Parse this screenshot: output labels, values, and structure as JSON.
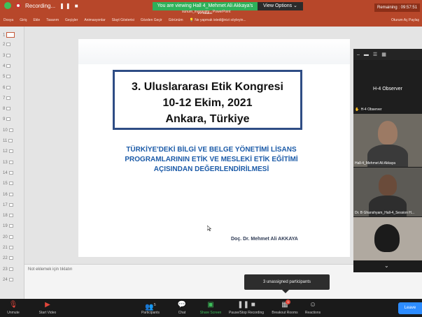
{
  "titlebar": {
    "recording": "Recording...",
    "banner": "You are viewing Hall 4_Mehmet Ali Akkaya's screen",
    "view_options": "View Options ⌄",
    "doc_title": "sunum_masaustu - PowerPoint",
    "remaining": "Remaining : 09:57:51"
  },
  "ribbon": {
    "tabs": [
      "Dosya",
      "Giriş",
      "Ekle",
      "Tasarım",
      "Geçişler",
      "Animasyonlar",
      "Slayt Gösterisi",
      "Gözden Geçir",
      "Görünüm"
    ],
    "search": "Ne yapmak istediğinizi söyleyin...",
    "user": "Oturum Aç  Paylaş"
  },
  "thumbs": [
    "1",
    "2",
    "3",
    "4",
    "5",
    "6",
    "7",
    "8",
    "9",
    "10",
    "11",
    "12",
    "13",
    "14",
    "15",
    "16",
    "17",
    "18",
    "19",
    "20",
    "21",
    "22",
    "23",
    "24"
  ],
  "slide": {
    "title_lines": [
      "3. Uluslararası Etik Kongresi",
      "10-12 Ekim, 2021",
      "Ankara, Türkiye"
    ],
    "subtitle_lines": [
      "TÜRKİYE'DEKİ BİLGİ VE BELGE YÖNETİMİ LİSANS",
      "PROGRAMLARININ ETİK VE MESLEKİ ETİK EĞİTİMİ",
      "AÇISINDAN DEĞERLENDİRİLMESİ"
    ],
    "author": "Doç. Dr. Mehmet Ali AKKAYA"
  },
  "notes": {
    "placeholder": "Not eklemek için tıklatın"
  },
  "videos": {
    "observer_name": "H-4 Observer",
    "observer_label": "H-4 Observer",
    "tile2_label": "Hall-4_Mehmet Ali Akkaya",
    "tile3_label": "Dr. B Ghanshyam_Hall-4_Session H..."
  },
  "tooltip": "3 unassigned participants",
  "toolbar": {
    "unmute": "Unmute",
    "start_video": "Start Video",
    "participants": "Participants",
    "participants_count": "5",
    "chat": "Chat",
    "share_screen": "Share Screen",
    "recording": "Pause/Stop Recording",
    "breakout": "Breakout Rooms",
    "breakout_badge": "3",
    "reactions": "Reactions",
    "leave": "Leave Room"
  },
  "colors": {
    "ppt_red": "#b7472a",
    "zoom_green": "#3ec15b",
    "title_border": "#2f4d85",
    "subtitle_blue": "#1c5ba8",
    "leave_blue": "#2d8cff"
  }
}
